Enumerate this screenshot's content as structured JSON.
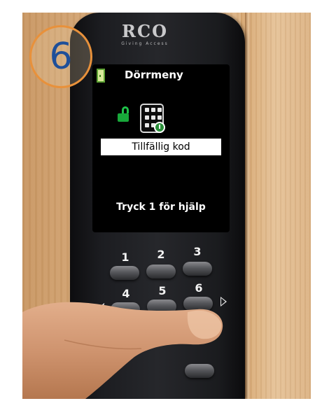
{
  "step_badge": {
    "number": "6"
  },
  "device": {
    "brand": "RCO",
    "tagline": "Giving Access",
    "screen": {
      "title": "Dörrmeny",
      "selected_option": "Tillfällig kod",
      "help": "Tryck 1 för hjälp",
      "icons": [
        "door-icon",
        "unlock-icon",
        "keypad-clock-icon"
      ]
    },
    "keys": [
      "1",
      "2",
      "3",
      "4",
      "5",
      "6"
    ],
    "nav_icons": [
      "arrow-left-icon",
      "arrow-right-icon"
    ]
  },
  "colors": {
    "badge_ring": "#e8913b",
    "badge_number": "#1f4f99",
    "screen_bg": "#000000",
    "lock_green": "#1fc34a"
  }
}
